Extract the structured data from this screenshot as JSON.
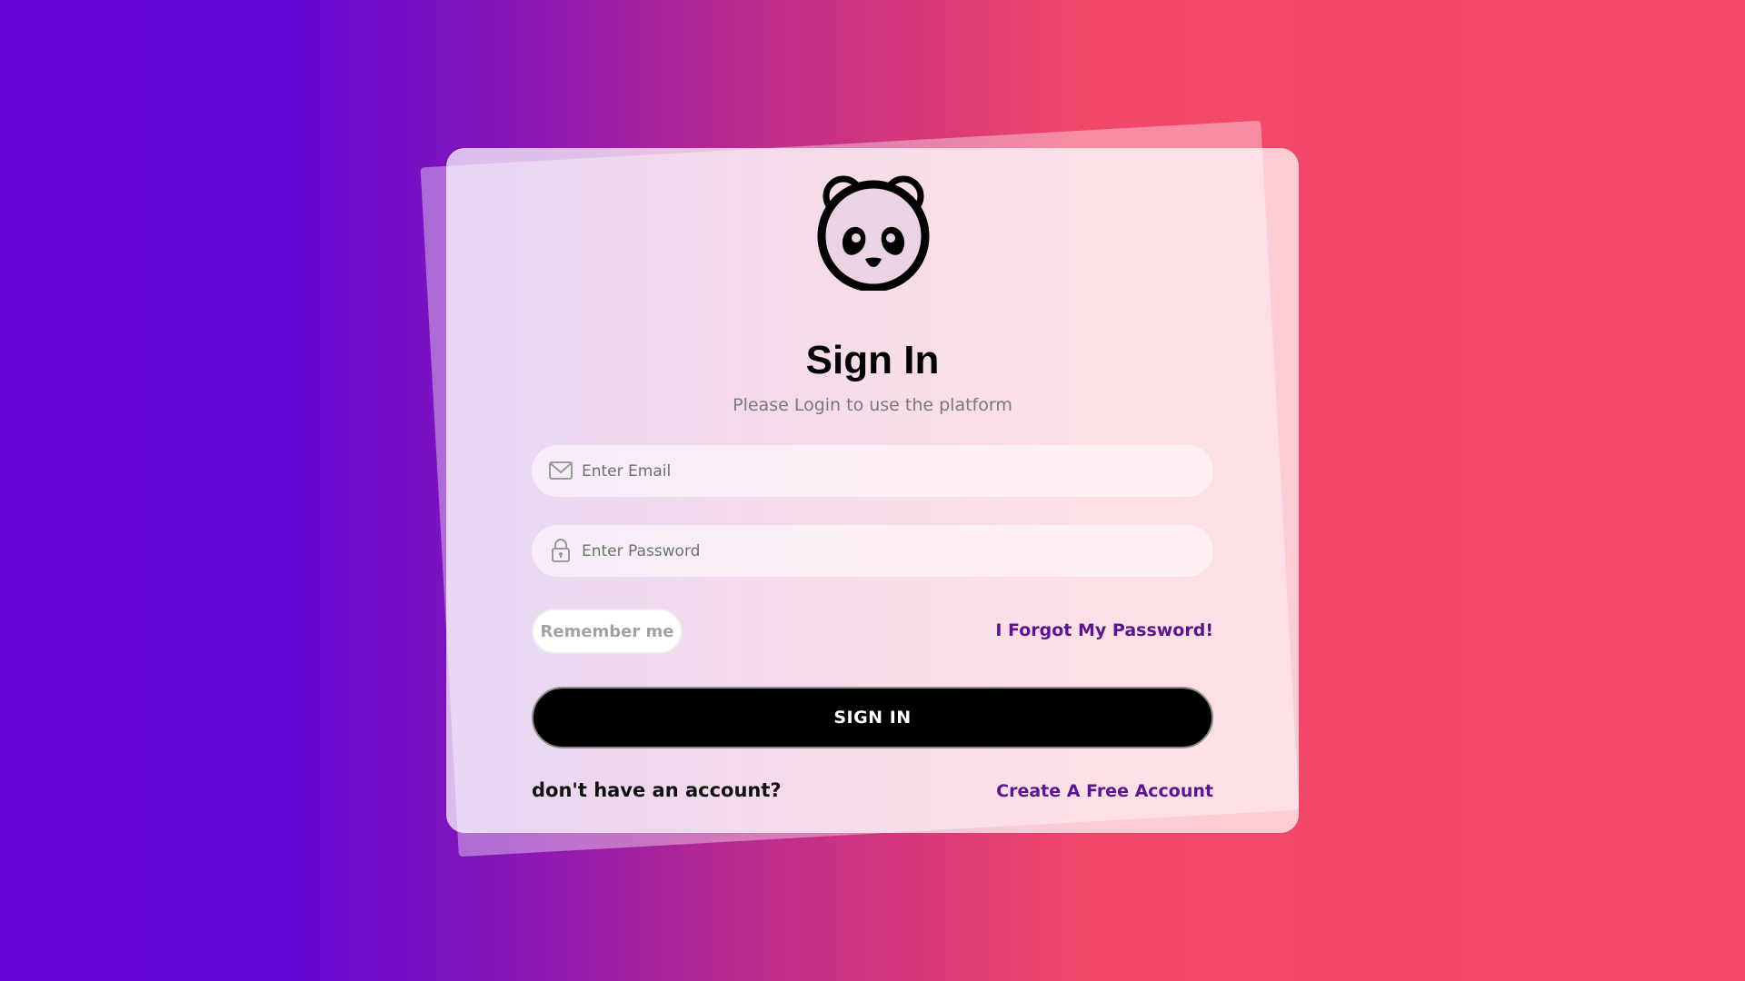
{
  "header": {
    "logo_icon": "panda-icon",
    "title": "Sign In",
    "subtitle": "Please Login to use the platform"
  },
  "form": {
    "email": {
      "icon": "mail-icon",
      "placeholder": "Enter Email",
      "value": ""
    },
    "password": {
      "icon": "lock-icon",
      "placeholder": "Enter Password",
      "value": ""
    },
    "remember_label": "Remember me",
    "forgot_label": "I Forgot My Password!",
    "submit_label": "SIGN IN"
  },
  "footer": {
    "prompt": "don't have an account?",
    "create_label": "Create A Free Account"
  },
  "colors": {
    "background_start": "#6304d3",
    "background_end": "#f44966",
    "link": "#5a1590",
    "button": "#000000"
  }
}
